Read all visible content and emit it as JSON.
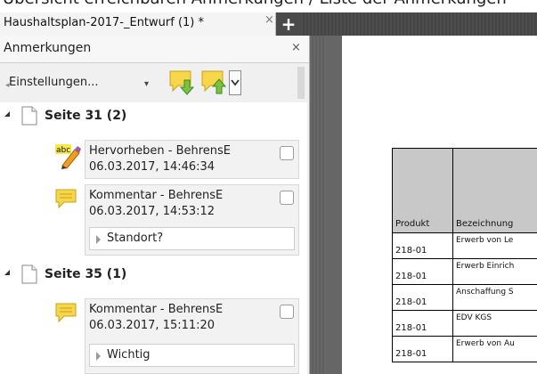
{
  "window": {
    "top_cut_text": "Übersicht erreichbaren Anmerkungen / Liste der Anmerkungen",
    "doc_tab_title": "Haushaltsplan-2017-_Entwurf (1) *",
    "tab_close_glyph": "×",
    "new_tab_glyph": "+"
  },
  "panel": {
    "title": "Anmerkungen",
    "close_glyph": "×",
    "toolbar": {
      "settings_label": "Einstellungen...",
      "settings_caret": "▾"
    }
  },
  "pages": [
    {
      "label": "Seite 31 (2)",
      "annotations": [
        {
          "type": "highlight",
          "line1": "Hervorheben - BehrensE",
          "line2": "06.03.2017, 14:46:34"
        },
        {
          "type": "comment",
          "line1": "Kommentar - BehrensE",
          "line2": "06.03.2017, 14:53:12",
          "reply": "Standort?"
        }
      ]
    },
    {
      "label": "Seite 35 (1)",
      "annotations": [
        {
          "type": "comment",
          "line1": "Kommentar - BehrensE",
          "line2": "06.03.2017, 15:11:20",
          "reply": "Wichtig"
        }
      ]
    }
  ],
  "document_table": {
    "headers": [
      "Produkt",
      "Bezeichnung"
    ],
    "rows": [
      [
        "218-01",
        "Erwerb von Le"
      ],
      [
        "218-01",
        "Erwerb Einrich"
      ],
      [
        "218-01",
        "Anschaffung S"
      ],
      [
        "218-01",
        "EDV KGS"
      ],
      [
        "218-01",
        "Erwerb von Au"
      ]
    ]
  },
  "colors": {
    "tabbar": "#4a4a4a",
    "panel_bg": "#f0f0f0",
    "doc_bg": "#666666",
    "table_header": "#c8c8c8",
    "comment_yellow": "#f5d21a"
  }
}
